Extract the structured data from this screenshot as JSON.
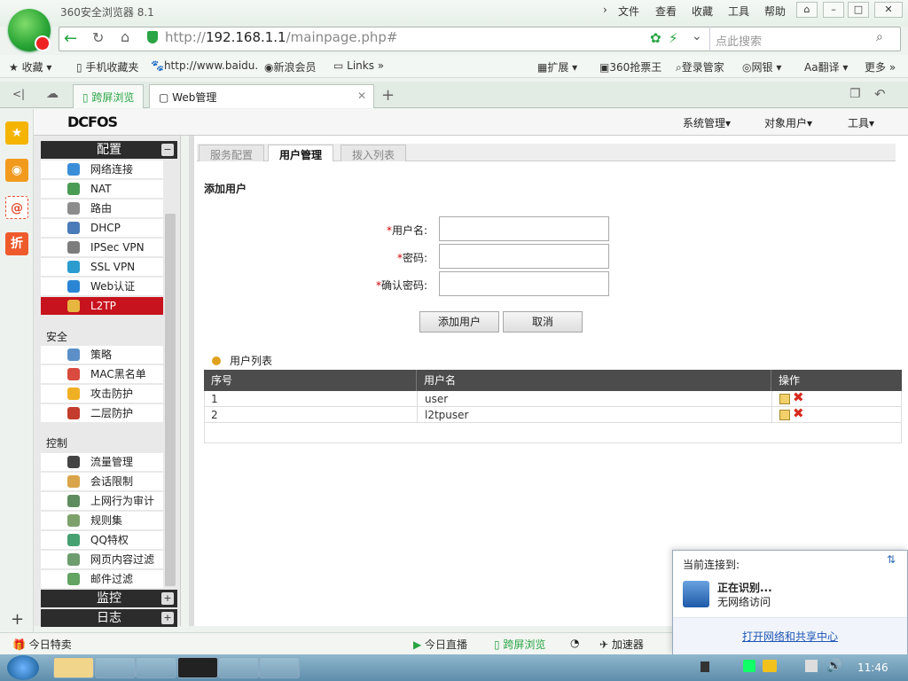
{
  "browser": {
    "title": "360安全浏览器 8.1",
    "menus": [
      "文件",
      "查看",
      "收藏",
      "工具",
      "帮助"
    ],
    "url_prefix": "http://",
    "url_host": "192.168.1.1",
    "url_path": "/mainpage.php#",
    "search_placeholder": "点此搜索",
    "bookmarks": [
      "收藏",
      "手机收藏夹",
      "http://www.baidu.",
      "新浪会员",
      "Links",
      "扩展",
      "360抢票王",
      "登录管家",
      "网银",
      "翻译",
      "更多"
    ],
    "tabs": [
      "跨屏浏览",
      "Web管理"
    ]
  },
  "app": {
    "brand": "DCFOS",
    "top_menu": [
      "系统管理▾",
      "对象用户▾",
      "工具▾"
    ],
    "sidebar": {
      "config_title": "配置",
      "config_items": [
        "网络连接",
        "NAT",
        "路由",
        "DHCP",
        "IPSec VPN",
        "SSL VPN",
        "Web认证",
        "L2TP"
      ],
      "security_title": "安全",
      "security_items": [
        "策略",
        "MAC黑名单",
        "攻击防护",
        "二层防护"
      ],
      "control_title": "控制",
      "control_items": [
        "流量管理",
        "会话限制",
        "上网行为审计",
        "规则集",
        "QQ特权",
        "网页内容过滤",
        "邮件过滤"
      ],
      "monitor_title": "监控",
      "log_title": "日志"
    },
    "content_tabs": [
      "服务配置",
      "用户管理",
      "拨入列表"
    ],
    "form": {
      "title": "添加用户",
      "username_label": "用户名:",
      "password_label": "密码:",
      "confirm_label": "确认密码:",
      "required_mark": "*",
      "add_button": "添加用户",
      "cancel_button": "取消"
    },
    "user_list": {
      "title": "用户列表",
      "headers": [
        "序号",
        "用户名",
        "操作"
      ],
      "rows": [
        {
          "no": "1",
          "name": "user"
        },
        {
          "no": "2",
          "name": "l2tpuser"
        }
      ]
    }
  },
  "status": {
    "today_deals": "今日特卖",
    "live": "今日直播",
    "cross": "跨屏浏览",
    "speed": "加速器"
  },
  "popup": {
    "title": "当前连接到:",
    "line1": "正在识别...",
    "line2": "无网络访问",
    "link": "打开网络和共享中心"
  },
  "taskbar": {
    "time": "11:46"
  }
}
